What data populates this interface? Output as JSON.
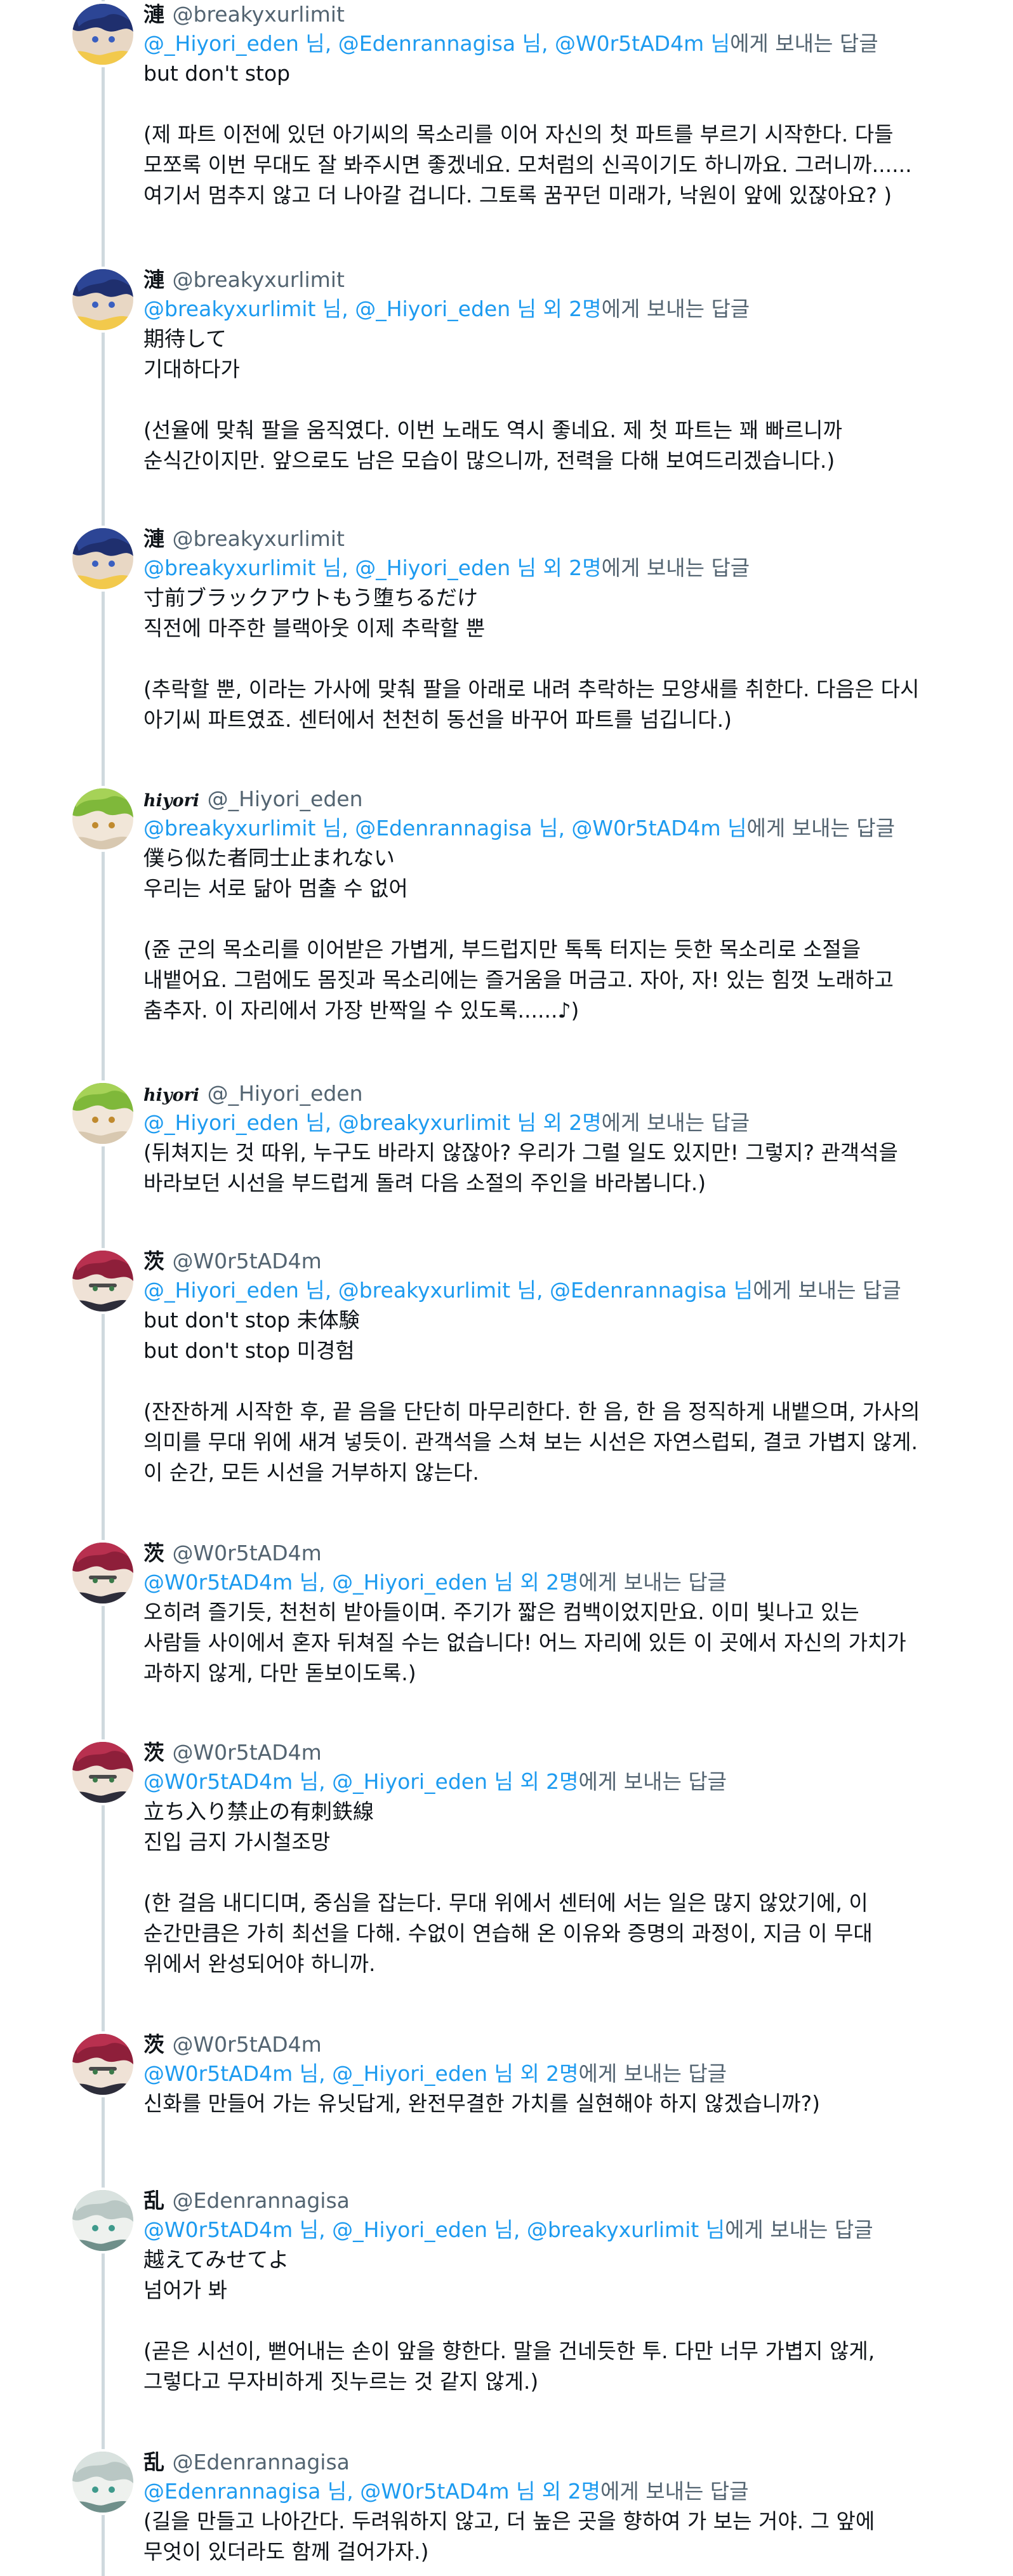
{
  "reply_suffix": "에게 보내는 답글",
  "tweets": [
    {
      "display_name": "漣",
      "handle": "@breakyxurlimit",
      "reply_to": "@_Hiyori_eden 님, @Edenrannagisa 님, @W0r5tAD4m 님",
      "lines": [
        "but don't stop",
        "",
        "(제 파트 이전에 있던 아기씨의 목소리를 이어 자신의 첫 파트를 부르기 시작한다. 다들",
        "모쪼록 이번 무대도 잘 봐주시면 좋겠네요. 모처럼의 신곡이기도 하니까요. 그러니까......",
        "여기서 멈추지 않고 더 나아갈 겁니다. 그토록 꿈꾸던 미래가, 낙원이 앞에 있잖아요? )"
      ]
    },
    {
      "display_name": "漣",
      "handle": "@breakyxurlimit",
      "reply_to": "@breakyxurlimit 님, @_Hiyori_eden 님 외 2명",
      "lines": [
        "期待して",
        "기대하다가",
        "",
        "(선율에 맞춰 팔을 움직였다. 이번 노래도 역시 좋네요. 제 첫 파트는 꽤 빠르니까",
        "순식간이지만. 앞으로도 남은 모습이 많으니까, 전력을 다해 보여드리겠습니다.)"
      ]
    },
    {
      "display_name": "漣",
      "handle": "@breakyxurlimit",
      "reply_to": "@breakyxurlimit 님, @_Hiyori_eden 님 외 2명",
      "lines": [
        "寸前ブラックアウトもう堕ちるだけ",
        "직전에 마주한 블랙아웃 이제 추락할 뿐",
        "",
        "(추락할 뿐, 이라는 가사에 맞춰 팔을 아래로 내려 추락하는 모양새를 취한다. 다음은 다시",
        "아기씨 파트였죠. 센터에서 천천히 동선을 바꾸어 파트를 넘깁니다.)"
      ]
    },
    {
      "display_name": "hiyori",
      "handle": "@_Hiyori_eden",
      "reply_to": "@breakyxurlimit 님, @Edenrannagisa 님, @W0r5tAD4m 님",
      "lines": [
        "僕ら似た者同士止まれない",
        "우리는 서로 닮아 멈출 수 없어",
        "",
        "(쥰 군의 목소리를 이어받은 가볍게, 부드럽지만 톡톡 터지는 듯한 목소리로 소절을",
        "내뱉어요. 그럼에도 몸짓과 목소리에는 즐거움을 머금고. 자아, 자! 있는 힘껏 노래하고",
        "춤추자. 이 자리에서 가장 반짝일 수 있도록......♪)"
      ]
    },
    {
      "display_name": "hiyori",
      "handle": "@_Hiyori_eden",
      "reply_to": "@_Hiyori_eden 님, @breakyxurlimit 님 외 2명",
      "lines": [
        "(뒤쳐지는 것 따위, 누구도 바라지 않잖아? 우리가 그럴 일도 있지만! 그렇지? 관객석을",
        "바라보던 시선을 부드럽게 돌려 다음 소절의 주인을 바라봅니다.)"
      ]
    },
    {
      "display_name": "茨",
      "handle": "@W0r5tAD4m",
      "reply_to": "@_Hiyori_eden 님, @breakyxurlimit 님, @Edenrannagisa 님",
      "lines": [
        "but don't stop 未体験",
        "but don't stop 미경험",
        "",
        "(잔잔하게 시작한 후, 끝 음을 단단히 마무리한다. 한 음, 한 음 정직하게 내뱉으며, 가사의",
        "의미를 무대 위에 새겨 넣듯이. 관객석을 스쳐 보는 시선은 자연스럽되, 결코 가볍지 않게.",
        "이 순간, 모든 시선을 거부하지 않는다."
      ]
    },
    {
      "display_name": "茨",
      "handle": "@W0r5tAD4m",
      "reply_to": "@W0r5tAD4m 님, @_Hiyori_eden 님 외 2명",
      "lines": [
        "오히려 즐기듯, 천천히 받아들이며. 주기가 짧은 컴백이었지만요. 이미 빛나고 있는",
        "사람들 사이에서 혼자 뒤쳐질 수는 없습니다! 어느 자리에 있든 이 곳에서 자신의 가치가",
        "과하지 않게, 다만 돋보이도록.)"
      ]
    },
    {
      "display_name": "茨",
      "handle": "@W0r5tAD4m",
      "reply_to": "@W0r5tAD4m 님, @_Hiyori_eden 님 외 2명",
      "lines": [
        "立ち入り禁止の有刺鉄線",
        "진입 금지 가시철조망",
        "",
        "(한 걸음 내디디며, 중심을 잡는다. 무대 위에서 센터에 서는 일은 많지 않았기에, 이",
        "순간만큼은 가히 최선을 다해. 수없이 연습해 온 이유와 증명의 과정이, 지금 이 무대",
        "위에서 완성되어야 하니까."
      ]
    },
    {
      "display_name": "茨",
      "handle": "@W0r5tAD4m",
      "reply_to": "@W0r5tAD4m 님, @_Hiyori_eden 님 외 2명",
      "lines": [
        "신화를 만들어 가는 유닛답게, 완전무결한 가치를 실현해야 하지 않겠습니까?)"
      ]
    },
    {
      "display_name": "乱",
      "handle": "@Edenrannagisa",
      "reply_to": "@W0r5tAD4m 님, @_Hiyori_eden 님, @breakyxurlimit 님",
      "lines": [
        "越えてみせてよ",
        "넘어가 봐",
        "",
        "(곧은 시선이, 뻗어내는 손이 앞을 향한다. 말을 건네듯한 투. 다만 너무 가볍지 않게,",
        "그렇다고 무자비하게 짓누르는 것 같지 않게.)"
      ]
    },
    {
      "display_name": "乱",
      "handle": "@Edenrannagisa",
      "reply_to": "@Edenrannagisa 님, @W0r5tAD4m 님 외 2명",
      "lines": [
        "(길을 만들고 나아간다. 두려워하지 않고, 더 높은 곳을 향하여 가 보는 거야. 그 앞에",
        "무엇이 있더라도 함께 걸어가자.)"
      ]
    }
  ],
  "avatar_icons": [
    "avatar-blue-hair",
    "avatar-green-hair",
    "avatar-red-hair",
    "avatar-silver-hair"
  ],
  "colors": {
    "link": "#1d9bf0",
    "secondary_text": "#536471",
    "primary_text": "#0f1419",
    "thread_line": "#cfd9de",
    "background": "#ffffff"
  }
}
